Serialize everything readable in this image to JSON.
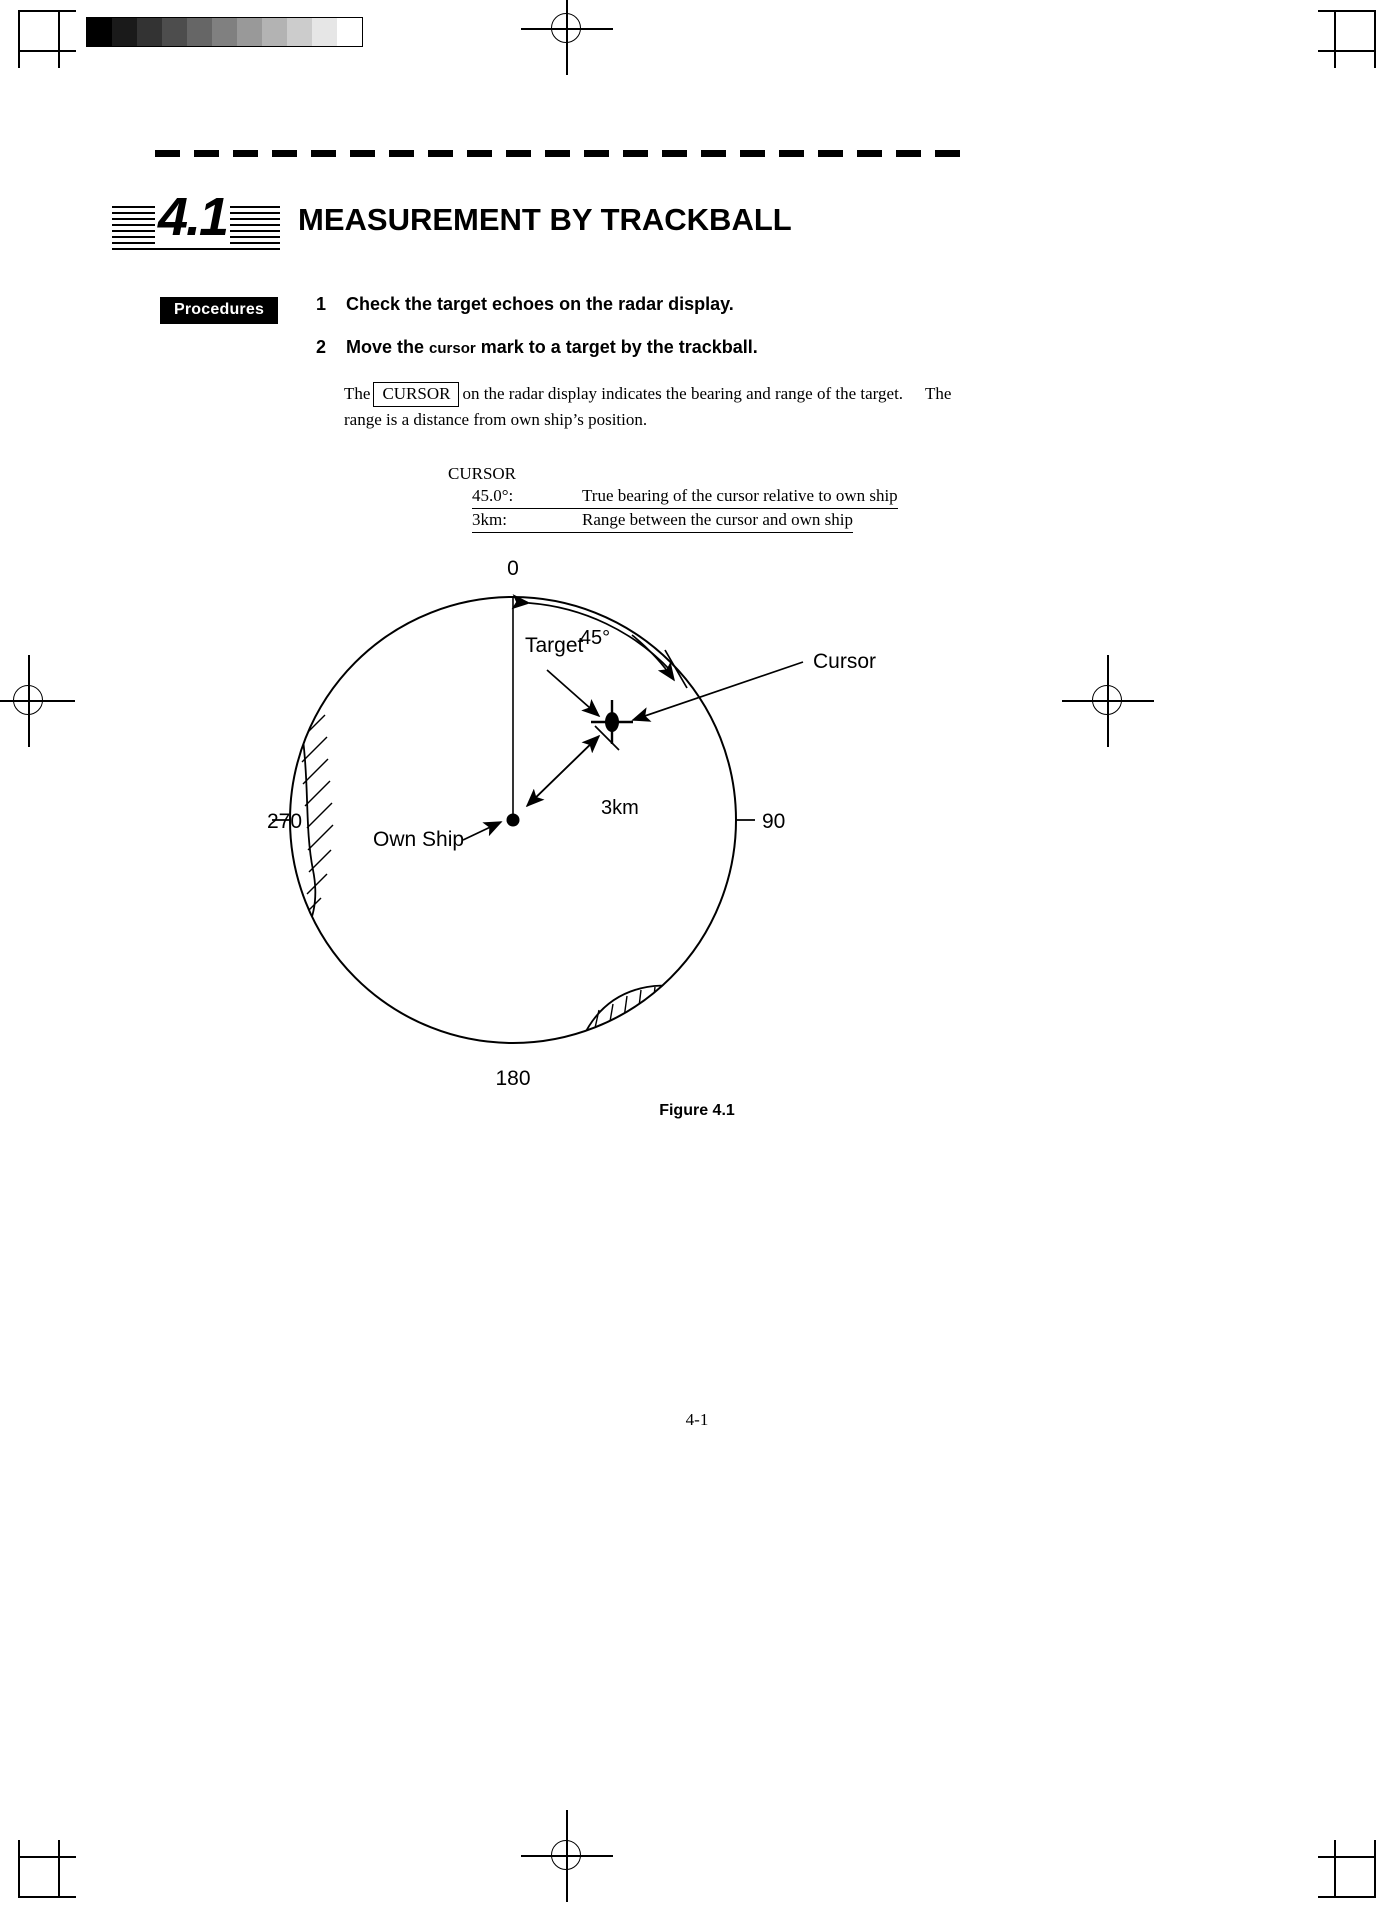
{
  "page": {
    "number": "4-1",
    "section_number": "4.1",
    "section_title": "MEASUREMENT BY TRACKBALL"
  },
  "grayscale_strip": {
    "name": "grayscale-calibration-strip",
    "swatches": [
      "#000000",
      "#1a1a1a",
      "#333333",
      "#4d4d4d",
      "#666666",
      "#808080",
      "#999999",
      "#b3b3b3",
      "#cccccc",
      "#e6e6e6",
      "#ffffff"
    ]
  },
  "procedures": {
    "badge_label": "Procedures",
    "steps": [
      {
        "num": "1",
        "text": "Check the target echoes on the radar display.",
        "emphasis": ""
      },
      {
        "num": "2",
        "text_before": "Move the ",
        "emphasis": "cursor",
        "text_after": " mark to a target by the trackball."
      }
    ]
  },
  "body": {
    "line1_before": "The",
    "boxed_term": "CURSOR",
    "line1_after": "on the radar display indicates the bearing and range of the target.",
    "line1_tail": "The",
    "line2": "range is a distance from own ship’s position."
  },
  "legend": {
    "title": "CURSOR",
    "rows": [
      {
        "key": "45.0°:",
        "value": "True bearing of the cursor relative to own ship"
      },
      {
        "key": "3km:",
        "value": "Range between the cursor and own ship"
      }
    ]
  },
  "figure": {
    "caption": "Figure 4.1",
    "bearing_labels": {
      "north": "0",
      "east": "90",
      "south": "180",
      "west": "270"
    },
    "annotations": {
      "angle": "45°",
      "range": "3km",
      "target": "Target",
      "cursor": "Cursor",
      "own_ship": "Own Ship"
    }
  },
  "colors": {
    "ink": "#000000",
    "paper": "#ffffff",
    "badge_bg": "#000000",
    "badge_fg": "#ffffff"
  }
}
